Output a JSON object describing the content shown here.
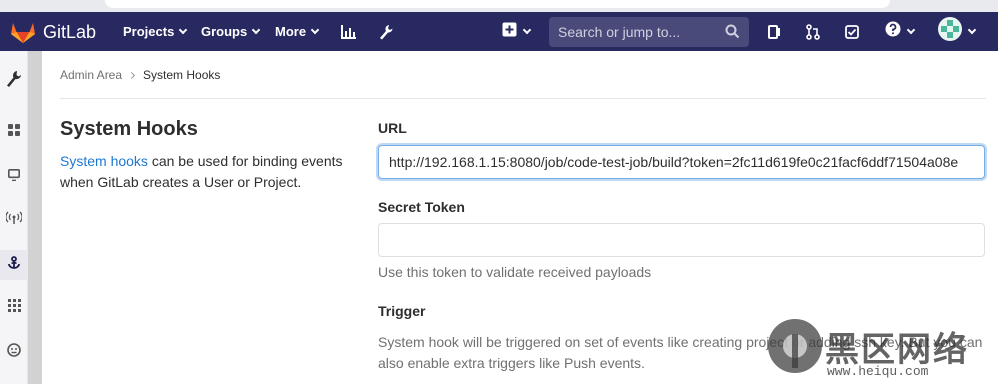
{
  "navbar": {
    "brand": "GitLab",
    "items": [
      {
        "label": "Projects"
      },
      {
        "label": "Groups"
      },
      {
        "label": "More"
      }
    ],
    "search_placeholder": "Search or jump to...",
    "colors": {
      "navbar_bg": "#292961",
      "accent": "#1f78d1"
    }
  },
  "sidebar": {
    "items": [
      {
        "icon": "wrench-icon",
        "active": false
      },
      {
        "icon": "overview-grid-icon",
        "active": false
      },
      {
        "icon": "monitoring-icon",
        "active": false
      },
      {
        "icon": "broadcast-icon",
        "active": false
      },
      {
        "icon": "hook-icon",
        "active": true
      },
      {
        "icon": "applications-grid-icon",
        "active": false
      },
      {
        "icon": "abuse-reports-icon",
        "active": false
      }
    ]
  },
  "breadcrumb": {
    "parent": "Admin Area",
    "current": "System Hooks"
  },
  "page": {
    "title": "System Hooks",
    "desc_link": "System hooks",
    "desc_rest": " can be used for binding events when GitLab creates a User or Project."
  },
  "form": {
    "url_label": "URL",
    "url_value": "http://192.168.1.15:8080/job/code-test-job/build?token=2fc11d619fe0c21facf6ddf71504a08e",
    "secret_label": "Secret Token",
    "secret_value": "",
    "secret_help": "Use this token to validate received payloads",
    "trigger_label": "Trigger",
    "trigger_help": "System hook will be triggered on set of events like creating project or adding ssh key. But you can also enable extra triggers like Push events."
  },
  "watermark": {
    "cn_text": "黑区网络",
    "url_text": "www.heiqu.com"
  }
}
